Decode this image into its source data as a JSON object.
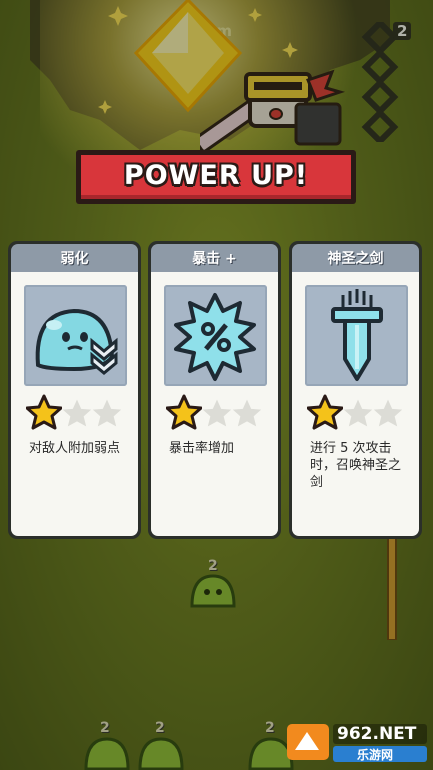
{
  "banner": {
    "title": "POWER UP!"
  },
  "hud": {
    "distance_text": "8m",
    "counter_text": "2"
  },
  "cards": [
    {
      "title": "弱化",
      "icon": "slime-weaken-icon",
      "stars_filled": 1,
      "stars_total": 3,
      "description": "对敌人附加弱点"
    },
    {
      "title": "暴击 +",
      "icon": "critical-percent-icon",
      "stars_filled": 1,
      "stars_total": 3,
      "description": "暴击率增加"
    },
    {
      "title": "神圣之剑",
      "icon": "holy-sword-icon",
      "stars_filled": 1,
      "stars_total": 3,
      "description": "进行 5 次攻击时，召唤神圣之剑"
    }
  ],
  "enemy_labels": [
    "2",
    "2",
    "2",
    "2"
  ],
  "watermark": {
    "brand": "962.NET",
    "sub": "乐游网"
  },
  "colors": {
    "banner_red": "#d8363b",
    "card_header": "#8e9aa7",
    "icon_bg": "#a7b6c6",
    "star_gold": "#f4c21a",
    "slime_teal": "#7fd6e0"
  }
}
